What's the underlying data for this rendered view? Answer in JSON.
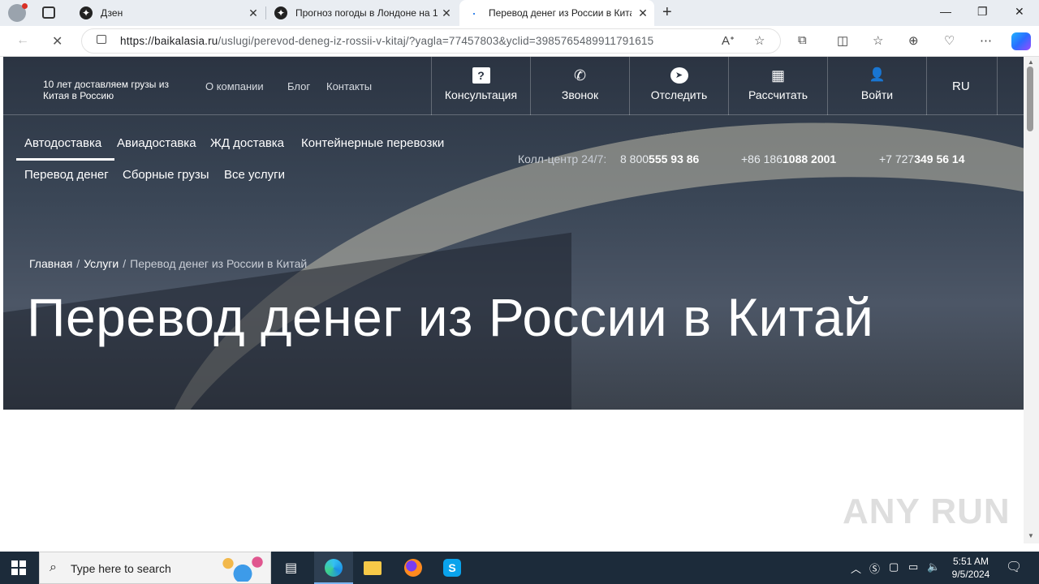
{
  "browser": {
    "tabs": [
      {
        "title": "Дзен",
        "icon": "dzen-icon"
      },
      {
        "title": "Прогноз погоды в Лондоне на 1",
        "icon": "dzen-icon"
      },
      {
        "title": "Перевод денег из России в Кита",
        "icon": "loading-icon"
      }
    ],
    "new_tab": "+",
    "close": "✕",
    "url_domain": "https://baikalasia.ru",
    "url_path": "/uslugi/perevod-deneg-iz-rossii-v-kitaj/?yagla=77457803&yclid=3985765489911791615"
  },
  "site": {
    "slogan": "10 лет доставляем грузы из Китая в Россию",
    "top_links": [
      "О компании",
      "Блог",
      "Контакты"
    ],
    "top_buttons": [
      {
        "label": "Консультация",
        "icon": "question-icon",
        "glyph": "?"
      },
      {
        "label": "Звонок",
        "icon": "phone-icon",
        "glyph": "✆"
      },
      {
        "label": "Отследить",
        "icon": "navigation-icon",
        "glyph": "➤"
      },
      {
        "label": "Рассчитать",
        "icon": "calculator-icon",
        "glyph": "▦"
      },
      {
        "label": "Войти",
        "icon": "user-icon",
        "glyph": "👤"
      }
    ],
    "lang": "RU",
    "menu_row1": [
      "Автодоставка",
      "Авиадоставка",
      "ЖД доставка",
      "Контейнерные перевозки"
    ],
    "menu_row2": [
      "Перевод денег",
      "Сборные грузы",
      "Все услуги"
    ],
    "call_center": "Колл-центр 24/7:",
    "phones": [
      {
        "prefix": "8 800",
        "number": "555 93 86"
      },
      {
        "prefix": "+86 186",
        "number": "1088 2001"
      },
      {
        "prefix": "+7 727",
        "number": "349 56 14"
      }
    ],
    "breadcrumbs": [
      "Главная",
      "Услуги",
      "Перевод денег из России в Китай"
    ],
    "heading": "Перевод денег из России в Китай"
  },
  "watermark": "ANY RUN",
  "taskbar": {
    "search_placeholder": "Type here to search",
    "time": "5:51 AM",
    "date": "9/5/2024"
  }
}
